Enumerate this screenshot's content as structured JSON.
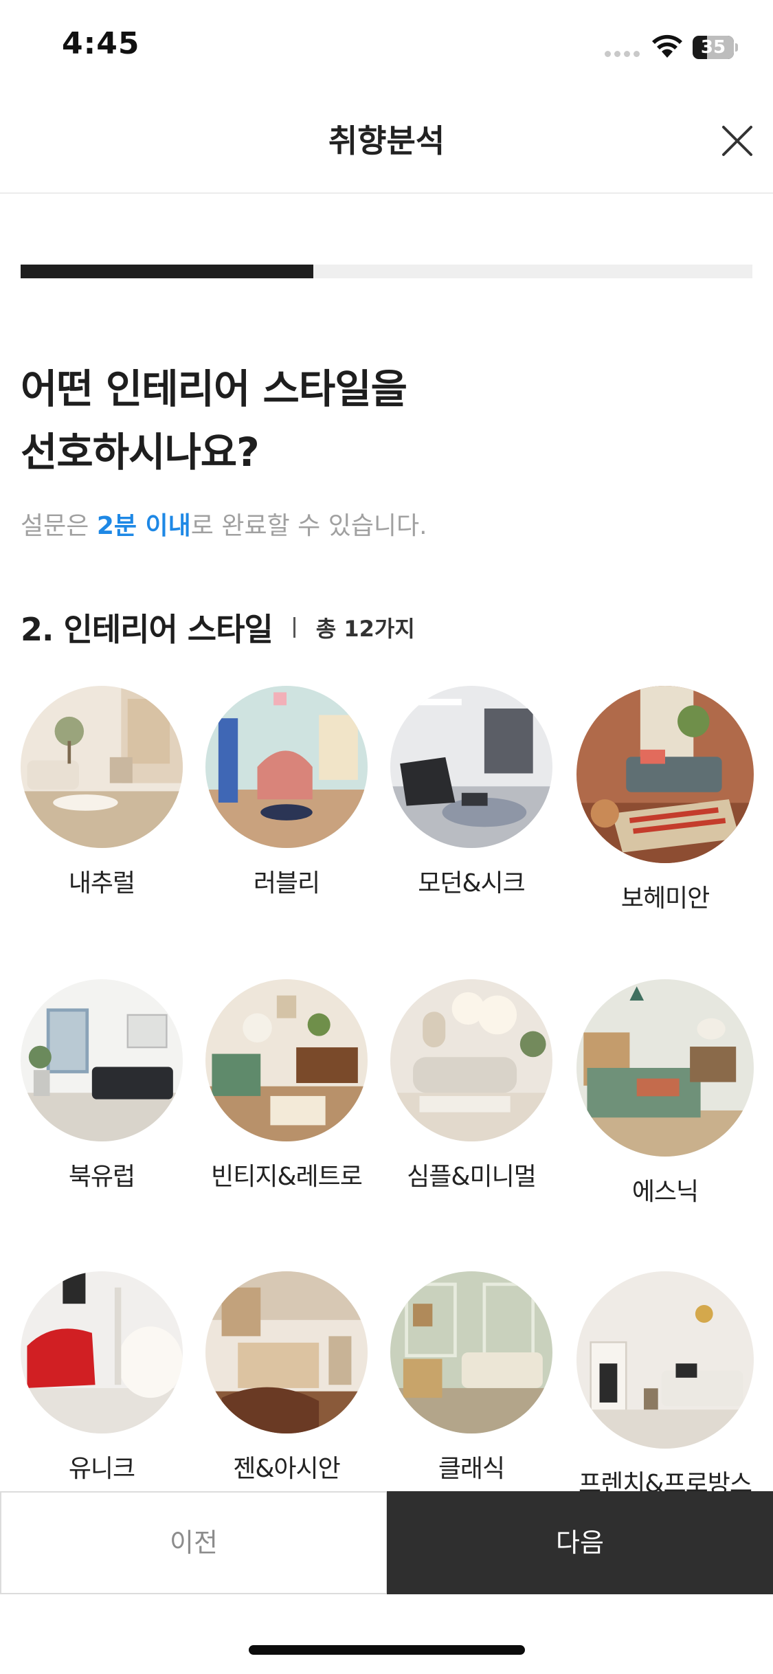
{
  "status_bar": {
    "time": "4:45",
    "battery": "35",
    "battery_level": 0.35
  },
  "header": {
    "title": "취향분석"
  },
  "progress": {
    "value": 0.4
  },
  "question": {
    "line1": "어떤 인테리어 스타일을",
    "line2": "선호하시나요?",
    "subtext_prefix": "설문은 ",
    "subtext_highlight": "2분 이내",
    "subtext_suffix": "로 완료할 수 있습니다."
  },
  "section": {
    "title": "2. 인테리어 스타일",
    "count": "총 12가지"
  },
  "styles": [
    {
      "label": "내추럴"
    },
    {
      "label": "러블리"
    },
    {
      "label": "모던&시크"
    },
    {
      "label": "보헤미안"
    },
    {
      "label": "북유럽"
    },
    {
      "label": "빈티지&레트로"
    },
    {
      "label": "심플&미니멀"
    },
    {
      "label": "에스닉"
    },
    {
      "label": "유니크"
    },
    {
      "label": "젠&아시안"
    },
    {
      "label": "클래식"
    },
    {
      "label": "프렌치&프로방스"
    }
  ],
  "buttons": {
    "prev": "이전",
    "next": "다음"
  },
  "colors": {
    "accent": "#1e88e5",
    "primary_button": "#2f2f2f",
    "progress": "#1e1e1e"
  }
}
